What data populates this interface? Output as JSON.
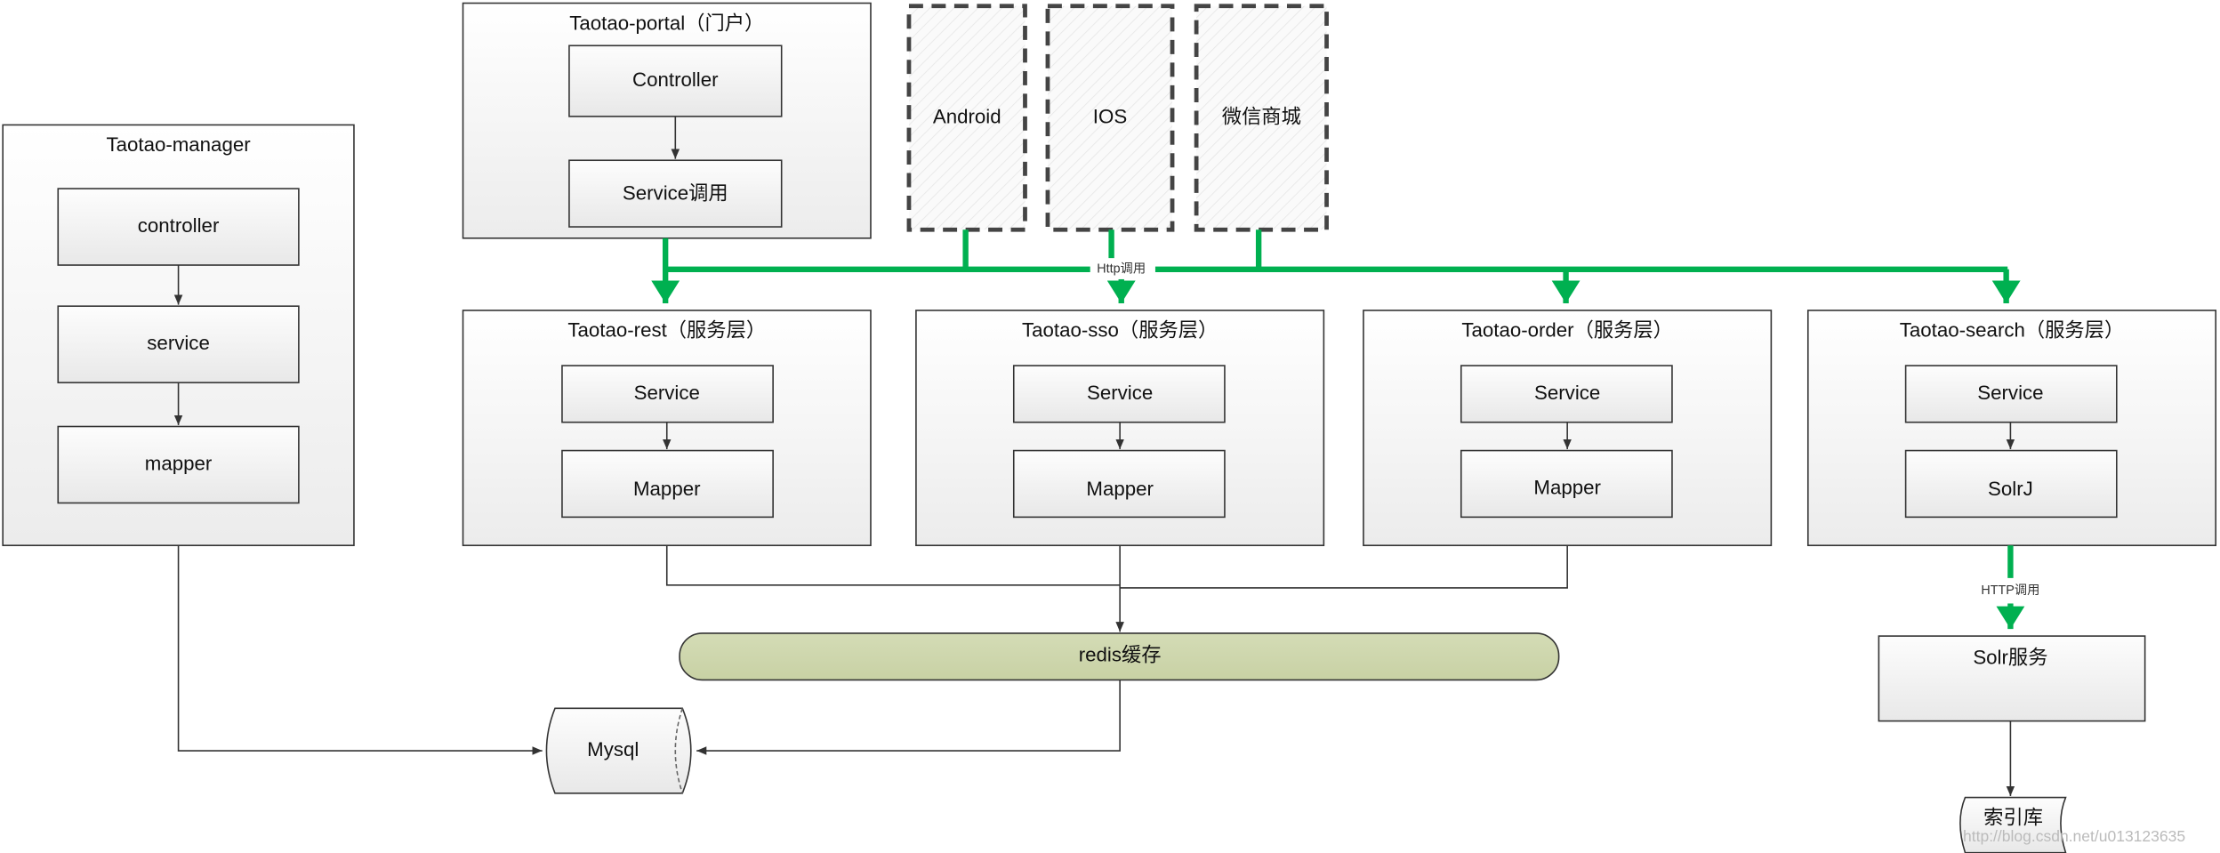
{
  "colors": {
    "bus": "#00b050",
    "cache": "#cdd6ad",
    "border": "#333333"
  },
  "manager": {
    "title": "Taotao-manager",
    "layers": [
      "controller",
      "service",
      "mapper"
    ]
  },
  "portal": {
    "title": "Taotao-portal（门户）",
    "layers": [
      "Controller",
      "Service调用"
    ]
  },
  "clients": [
    "Android",
    "IOS",
    "微信商城"
  ],
  "bus_label": "Http调用",
  "services": [
    {
      "title": "Taotao-rest（服务层）",
      "layers": [
        "Service",
        "Mapper"
      ]
    },
    {
      "title": "Taotao-sso（服务层）",
      "layers": [
        "Service",
        "Mapper"
      ]
    },
    {
      "title": "Taotao-order（服务层）",
      "layers": [
        "Service",
        "Mapper"
      ]
    },
    {
      "title": "Taotao-search（服务层）",
      "layers": [
        "Service",
        "SolrJ"
      ]
    }
  ],
  "cache": "redis缓存",
  "database": "Mysql",
  "search_link_label": "HTTP调用",
  "solr_service": "Solr服务",
  "index_store": "索引库",
  "watermark": "http://blog.csdn.net/u013123635"
}
